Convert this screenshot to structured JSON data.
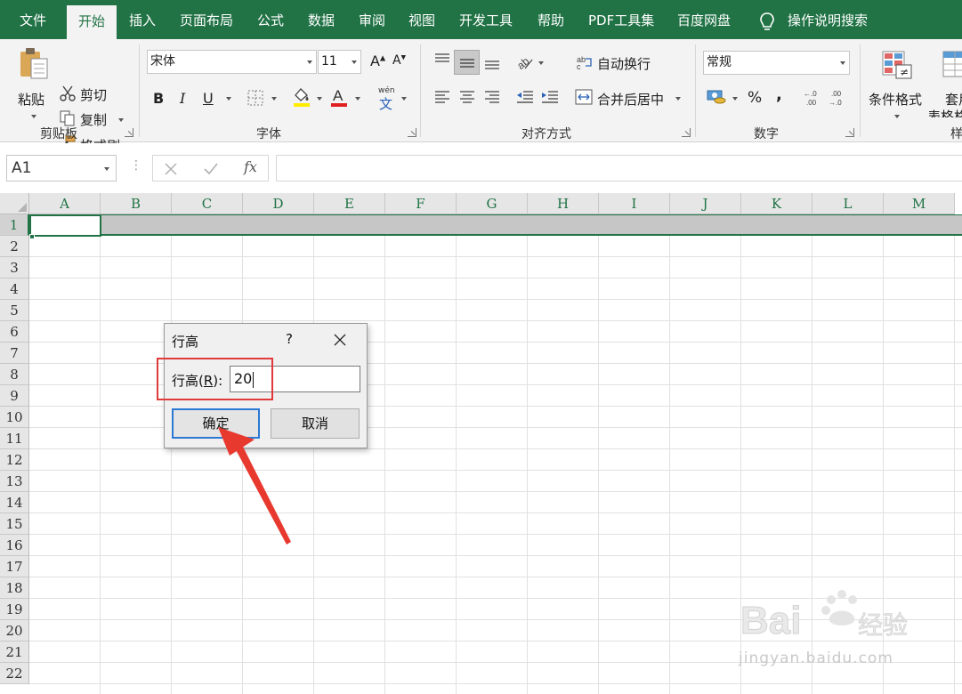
{
  "tabs": [
    "文件",
    "开始",
    "插入",
    "页面布局",
    "公式",
    "数据",
    "审阅",
    "视图",
    "开发工具",
    "帮助",
    "PDF工具集",
    "百度网盘"
  ],
  "active_tab": "开始",
  "tell_me": "操作说明搜索",
  "clipboard": {
    "paste": "粘贴",
    "cut": "剪切",
    "copy": "复制",
    "format_painter": "格式刷",
    "group": "剪贴板"
  },
  "font": {
    "name": "宋体",
    "size": "11",
    "bold": "B",
    "italic": "I",
    "underline": "U",
    "group": "字体",
    "wen": "wén",
    "wen_char": "文"
  },
  "alignment": {
    "wrap_text": "自动换行",
    "merge_center": "合并后居中",
    "group": "对齐方式"
  },
  "number": {
    "format": "常规",
    "percent": "%",
    "comma": ",",
    "group": "数字"
  },
  "styles": {
    "conditional": "条件格式",
    "table_line1": "套用",
    "table_line2": "表格格",
    "group": "样"
  },
  "formula_bar": {
    "name_box": "A1",
    "fx": "fx",
    "formula": ""
  },
  "columns": [
    "A",
    "B",
    "C",
    "D",
    "E",
    "F",
    "G",
    "H",
    "I",
    "J",
    "K",
    "L",
    "M"
  ],
  "rows": [
    "1",
    "2",
    "3",
    "4",
    "5",
    "6",
    "7",
    "8",
    "9",
    "10",
    "11",
    "12",
    "13",
    "14",
    "15",
    "16",
    "17",
    "18",
    "19",
    "20",
    "21",
    "22"
  ],
  "selected_row": "1",
  "dialog": {
    "title": "行高",
    "help": "?",
    "label": "行高(R):",
    "label_pre": "行高(",
    "label_key": "R",
    "label_post": "):",
    "value": "20",
    "ok": "确定",
    "cancel": "取消"
  },
  "colors": {
    "accent": "#217346",
    "highlight": "#e03a3a",
    "focus": "#2b79d3"
  },
  "watermark": {
    "text": "jingyan.baidu.com",
    "brand": "Baidu经验"
  }
}
